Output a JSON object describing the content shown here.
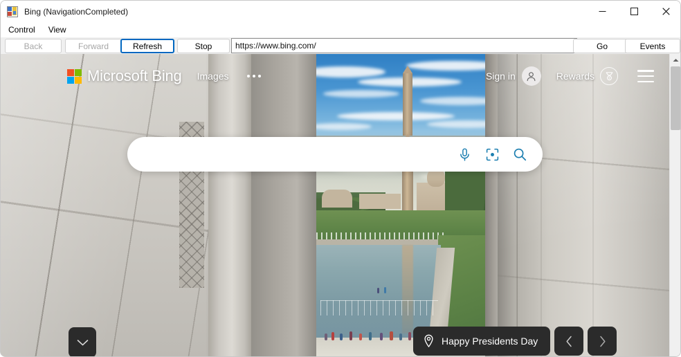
{
  "window": {
    "title": "Bing (NavigationCompleted)",
    "app_icon": "winforms-app-icon",
    "minimize_label": "Minimize",
    "maximize_label": "Maximize",
    "close_label": "Close"
  },
  "menu": {
    "items": [
      {
        "label": "Control"
      },
      {
        "label": "View"
      }
    ]
  },
  "toolbar": {
    "back_label": "Back",
    "forward_label": "Forward",
    "refresh_label": "Refresh",
    "stop_label": "Stop",
    "go_label": "Go",
    "events_label": "Events",
    "url_value": "https://www.bing.com/",
    "url_placeholder": "https://www.bing.com/",
    "back_enabled": false,
    "forward_enabled": false,
    "refresh_focused": true
  },
  "page": {
    "header": {
      "brand": "Microsoft Bing",
      "logo": "microsoft-logo",
      "logo_colors": {
        "red": "#f25022",
        "green": "#7fba00",
        "blue": "#00a4ef",
        "yellow": "#ffb900"
      },
      "images_label": "Images",
      "more_label": "more-options",
      "sign_in_label": "Sign in",
      "avatar_icon": "person-icon",
      "rewards_label": "Rewards",
      "rewards_icon": "medal-icon",
      "menu_icon": "hamburger-icon"
    },
    "search": {
      "value": "",
      "placeholder": "",
      "mic_icon": "microphone-icon",
      "visual_icon": "camera-visual-search-icon",
      "submit_icon": "search-icon",
      "icon_color": "#1b7eb0"
    },
    "bottom": {
      "scroll_down_icon": "chevron-down-icon",
      "info_icon": "location-pin-icon",
      "info_label": "Happy Presidents Day",
      "prev_icon": "chevron-left-icon",
      "next_icon": "chevron-right-icon",
      "pill_bg": "#2b2b2b"
    },
    "background": {
      "description": "Washington Monument and Reflecting Pool viewed between the marble columns of the Lincoln Memorial"
    }
  },
  "scrollbar": {
    "up_arrow_icon": "scroll-up-arrow-icon",
    "thumb_label": "scroll-thumb"
  }
}
